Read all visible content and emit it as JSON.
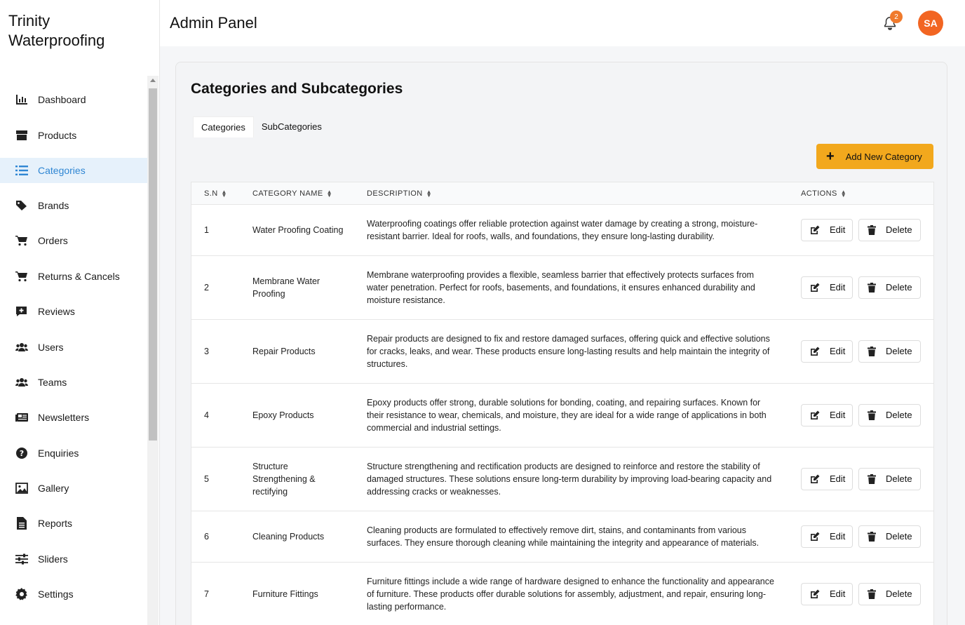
{
  "brand": {
    "line1": "Trinity",
    "line2": "Waterproofing"
  },
  "sidebar": {
    "items": [
      {
        "label": "Dashboard",
        "icon": "bar-chart-icon"
      },
      {
        "label": "Products",
        "icon": "box-icon"
      },
      {
        "label": "Categories",
        "icon": "list-icon",
        "active": true
      },
      {
        "label": "Brands",
        "icon": "tags-icon"
      },
      {
        "label": "Orders",
        "icon": "cart-icon"
      },
      {
        "label": "Returns & Cancels",
        "icon": "cart-icon"
      },
      {
        "label": "Reviews",
        "icon": "comment-plus-icon"
      },
      {
        "label": "Users",
        "icon": "users-icon"
      },
      {
        "label": "Teams",
        "icon": "users-icon"
      },
      {
        "label": "Newsletters",
        "icon": "newspaper-icon"
      },
      {
        "label": "Enquiries",
        "icon": "question-circle-icon"
      },
      {
        "label": "Gallery",
        "icon": "image-icon"
      },
      {
        "label": "Reports",
        "icon": "file-icon"
      },
      {
        "label": "Sliders",
        "icon": "sliders-icon"
      },
      {
        "label": "Settings",
        "icon": "gear-icon"
      }
    ]
  },
  "header": {
    "title": "Admin Panel",
    "notification_count": "2",
    "avatar_initials": "SA"
  },
  "page": {
    "title": "Categories and Subcategories",
    "tabs": [
      "Categories",
      "SubCategories"
    ],
    "add_button": "Add New Category"
  },
  "table": {
    "columns": [
      "S.N",
      "CATEGORY NAME",
      "DESCRIPTION",
      "ACTIONS"
    ],
    "edit_label": "Edit",
    "delete_label": "Delete",
    "rows": [
      {
        "sn": "1",
        "name": "Water Proofing Coating",
        "description": "Waterproofing coatings offer reliable protection against water damage by creating a strong, moisture-resistant barrier. Ideal for roofs, walls, and foundations, they ensure long-lasting durability."
      },
      {
        "sn": "2",
        "name": "Membrane Water Proofing",
        "description": "Membrane waterproofing provides a flexible, seamless barrier that effectively protects surfaces from water penetration. Perfect for roofs, basements, and foundations, it ensures enhanced durability and moisture resistance."
      },
      {
        "sn": "3",
        "name": "Repair Products",
        "description": "Repair products are designed to fix and restore damaged surfaces, offering quick and effective solutions for cracks, leaks, and wear. These products ensure long-lasting results and help maintain the integrity of structures."
      },
      {
        "sn": "4",
        "name": "Epoxy Products",
        "description": "Epoxy products offer strong, durable solutions for bonding, coating, and repairing surfaces. Known for their resistance to wear, chemicals, and moisture, they are ideal for a wide range of applications in both commercial and industrial settings."
      },
      {
        "sn": "5",
        "name": "Structure Strengthening & rectifying",
        "description": "Structure strengthening and rectification products are designed to reinforce and restore the stability of damaged structures. These solutions ensure long-term durability by improving load-bearing capacity and addressing cracks or weaknesses."
      },
      {
        "sn": "6",
        "name": "Cleaning Products",
        "description": "Cleaning products are formulated to effectively remove dirt, stains, and contaminants from various surfaces. They ensure thorough cleaning while maintaining the integrity and appearance of materials."
      },
      {
        "sn": "7",
        "name": "Furniture Fittings",
        "description": "Furniture fittings include a wide range of hardware designed to enhance the functionality and appearance of furniture. These products offer durable solutions for assembly, adjustment, and repair, ensuring long-lasting performance."
      }
    ]
  },
  "colors": {
    "accent": "#2f86d3",
    "add_button": "#f2a81d",
    "avatar": "#f26522",
    "badge": "#f07a2c"
  }
}
